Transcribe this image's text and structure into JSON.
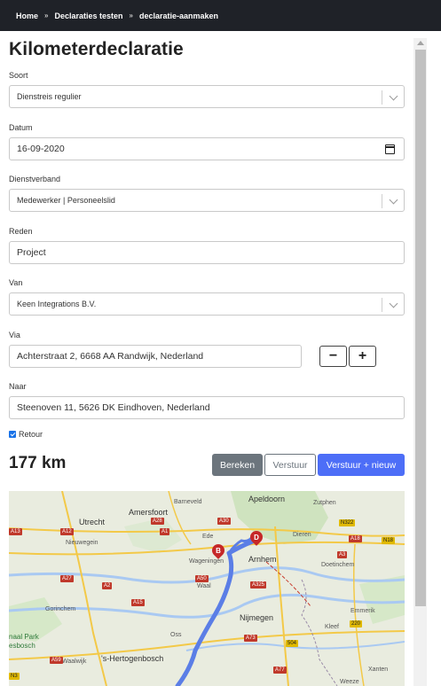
{
  "breadcrumb": {
    "items": [
      "Home",
      "Declaraties testen",
      "declaratie-aanmaken"
    ],
    "separator": "»"
  },
  "page": {
    "title": "Kilometerdeclaratie"
  },
  "form": {
    "soort": {
      "label": "Soort",
      "value": "Dienstreis regulier"
    },
    "datum": {
      "label": "Datum",
      "value": "16-09-2020"
    },
    "dienstverband": {
      "label": "Dienstverband",
      "value": "Medewerker | Personeelslid"
    },
    "reden": {
      "label": "Reden",
      "value": "Project"
    },
    "van": {
      "label": "Van",
      "value": "Keen Integrations B.V."
    },
    "via": {
      "label": "Via",
      "value": "Achterstraat 2, 6668 AA Randwijk, Nederland",
      "remove_label": "−",
      "add_label": "+"
    },
    "naar": {
      "label": "Naar",
      "value": "Steenoven 11, 5626 DK Eindhoven, Nederland"
    },
    "retour": {
      "label": "Retour",
      "checked": true
    }
  },
  "result": {
    "distance": "177 km"
  },
  "actions": {
    "calculate": "Bereken",
    "send": "Verstuur",
    "send_new": "Verstuur + nieuw"
  },
  "map": {
    "places": [
      "Amersfoort",
      "Barneveld",
      "Apeldoorn",
      "Zutphen",
      "Utrecht",
      "Nieuwegein",
      "Ede",
      "Dieren",
      "Wageningen",
      "Arnhem",
      "Doetinchem",
      "Waal",
      "Nijmegen",
      "Emmerik",
      "Kleef",
      "Gorinchem",
      "Oss",
      "'s-Hertogenbosch",
      "Waalwijk",
      "Weeze",
      "Xanten"
    ],
    "partial_labels": [
      "naal Park",
      "esbosch"
    ],
    "roads": [
      "A28",
      "A1",
      "A12",
      "A2",
      "A27",
      "A15",
      "A50",
      "A325",
      "A73",
      "A59",
      "A77",
      "A3",
      "A18",
      "N322",
      "N18",
      "504",
      "220",
      "N3",
      "A30",
      "A13"
    ],
    "markers": [
      "B",
      "D"
    ],
    "colors": {
      "route": "#5b7ee6",
      "marker": "#c62828",
      "water": "#a9c9f2",
      "forest": "#cfe3bf"
    }
  },
  "colors": {
    "topbar": "#1f2228",
    "primary": "#4d6ef7",
    "secondary": "#6c757d",
    "checkbox": "#1a73e8"
  }
}
